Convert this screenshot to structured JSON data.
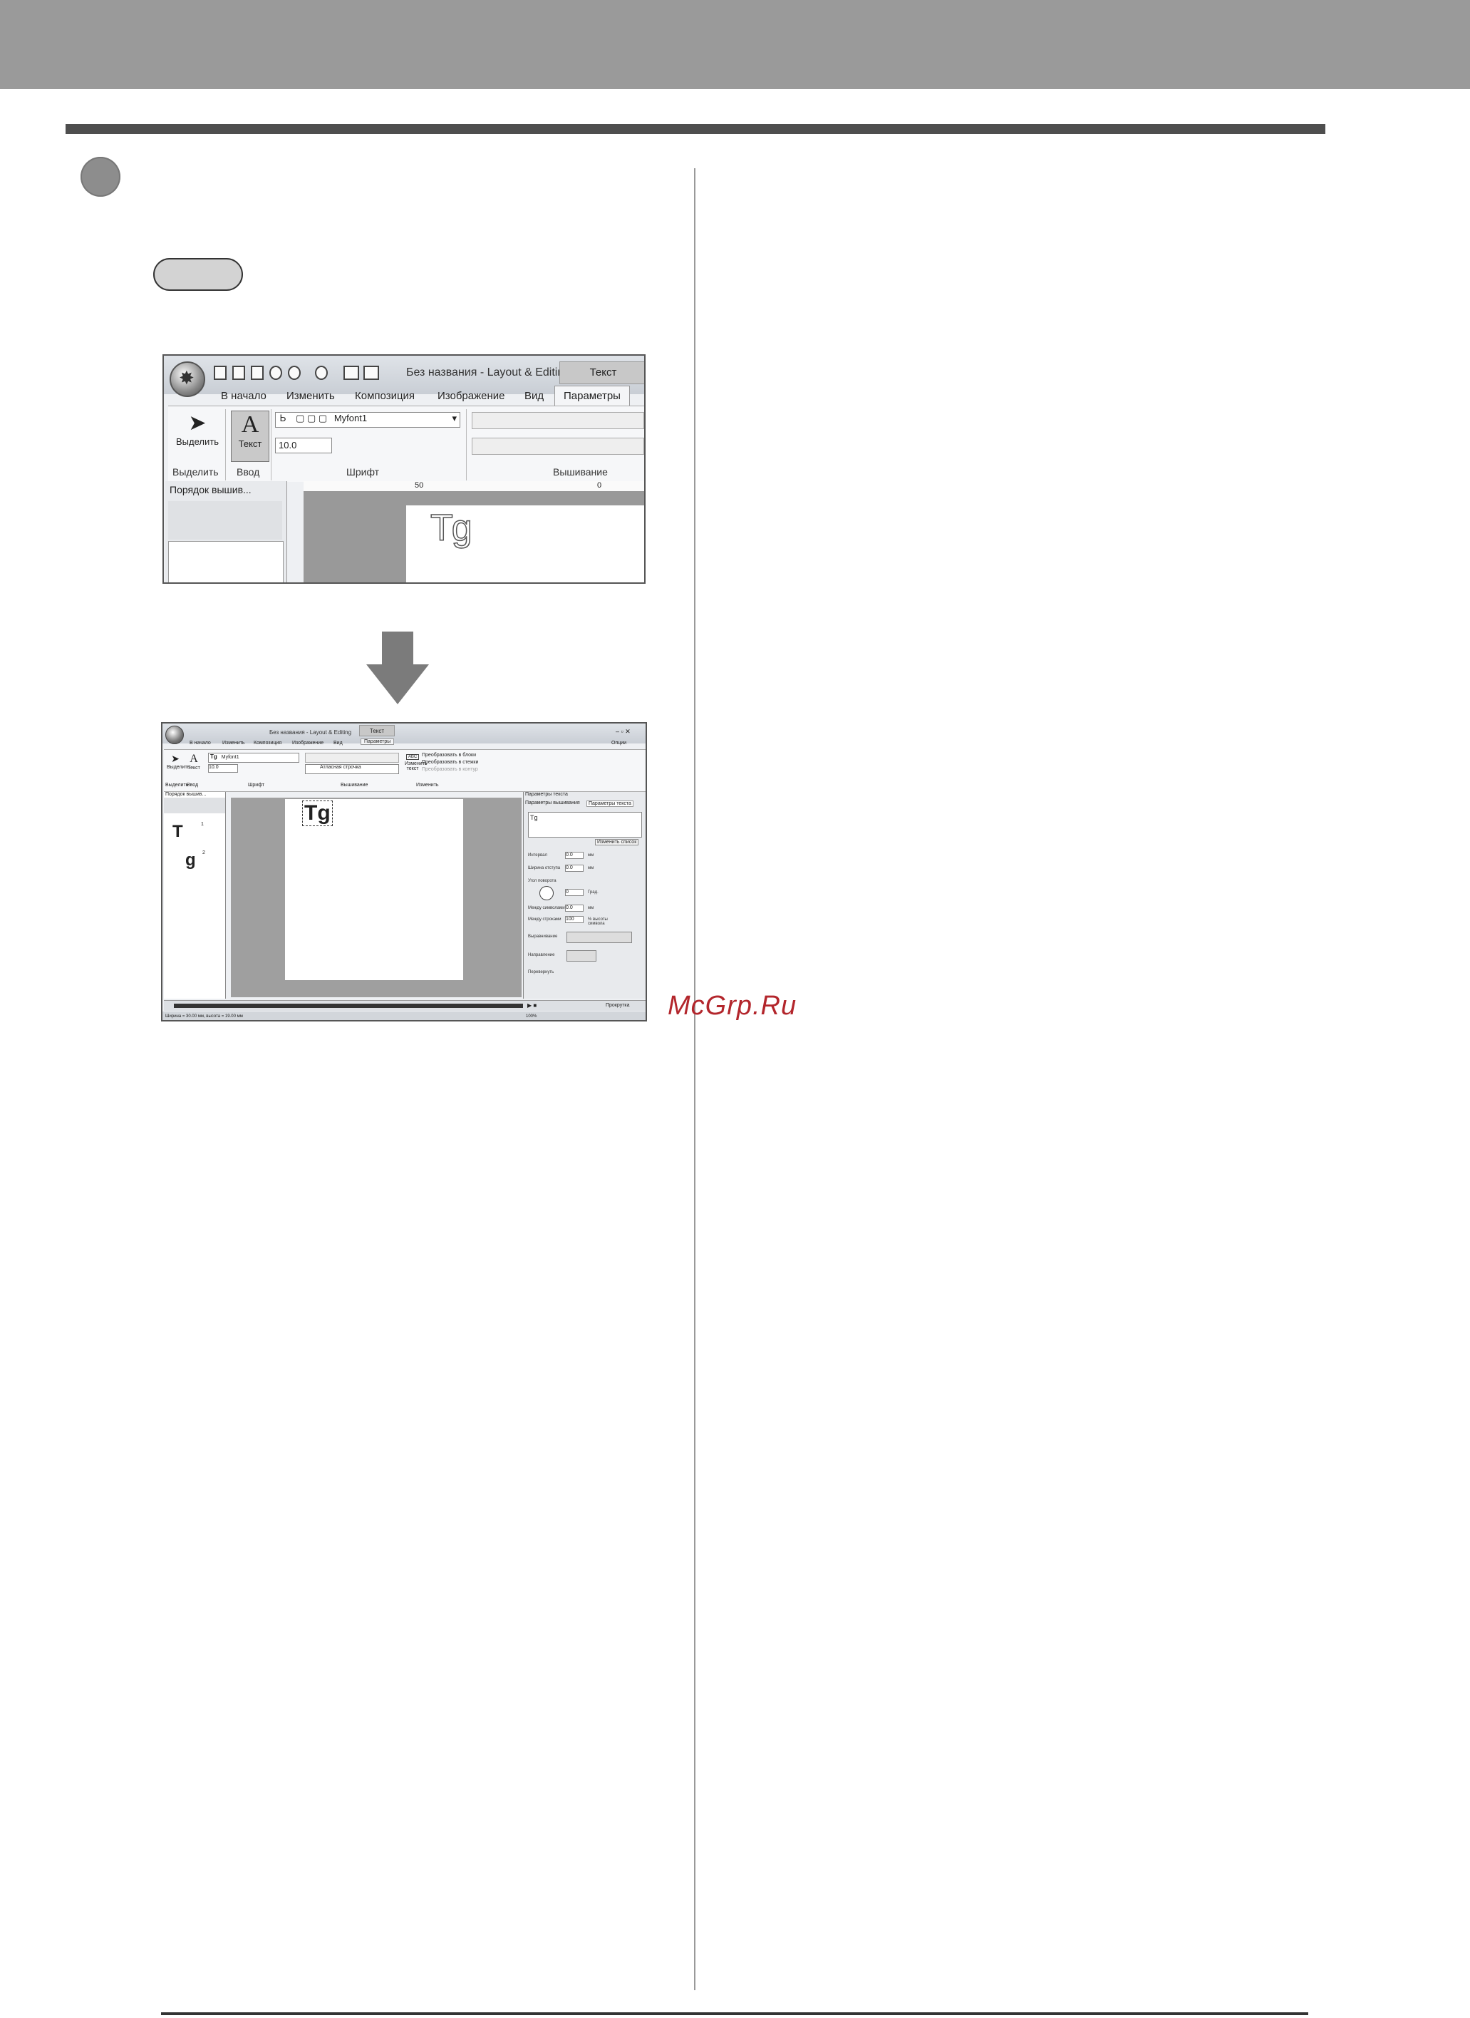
{
  "watermark": "McGrp.Ru",
  "screenshot1": {
    "window_title": "Без названия - Layout & Editing",
    "context_tab": "Текст",
    "tabs": [
      "В начало",
      "Изменить",
      "Композиция",
      "Изображение",
      "Вид",
      "Параметры"
    ],
    "buttons": {
      "select": "Выделить",
      "text": "Текст"
    },
    "font_name": "Myfont1",
    "font_size": "10.0",
    "group_labels": [
      "Выделить",
      "Ввод",
      "Шрифт",
      "Вышивание"
    ],
    "panel_title": "Порядок вышив...",
    "ruler_marks": [
      "50",
      "0"
    ],
    "canvas_text": "Tg"
  },
  "screenshot2": {
    "window_title": "Без названия - Layout & Editing",
    "context_tab": "Текст",
    "tabs": [
      "В начало",
      "Изменить",
      "Композиция",
      "Изображение",
      "Вид",
      "Параметры"
    ],
    "options_label": "Опции",
    "buttons": {
      "select": "Выделить",
      "text": "Текст",
      "edit_text": "Изменить текст"
    },
    "font_name": "Myfont1",
    "font_size": "10.0",
    "stitch_type": "Атласная строчка",
    "convert_options": [
      "Преобразовать в блоки",
      "Преобразовать в стежки",
      "Преобразовать в контур"
    ],
    "group_labels": [
      "Выделить",
      "Ввод",
      "Шрифт",
      "Вышивание",
      "Изменить"
    ],
    "left_panel_title": "Порядок вышив...",
    "order_items": [
      {
        "glyph": "T",
        "index": "1"
      },
      {
        "glyph": "g",
        "index": "2"
      }
    ],
    "canvas_text": "Tg",
    "right_panel_title": "Параметры текста",
    "right_tabs": [
      "Параметры вышивания",
      "Параметры текста"
    ],
    "text_value": "Tg",
    "change_list_btn": "Изменить список",
    "params": [
      {
        "label": "Интервал",
        "value": "0.0",
        "unit": "мм"
      },
      {
        "label": "Ширина отступа",
        "value": "0.0",
        "unit": "мм"
      },
      {
        "label": "Угол поворота",
        "value": "0",
        "unit": "Град."
      },
      {
        "label": "Между символами",
        "value": "0.0",
        "unit": "мм"
      },
      {
        "label": "Между строками",
        "value": "100",
        "unit": "% высоты символа"
      }
    ],
    "align_label": "Выравнивание",
    "direction_label": "Направление",
    "checkbox_label": "Перевернуть",
    "status_text": "Ширина = 30.00 мм, высота = 19.00 мм",
    "zoom": "100%",
    "bottom_checkbox": "Прокрутка"
  }
}
